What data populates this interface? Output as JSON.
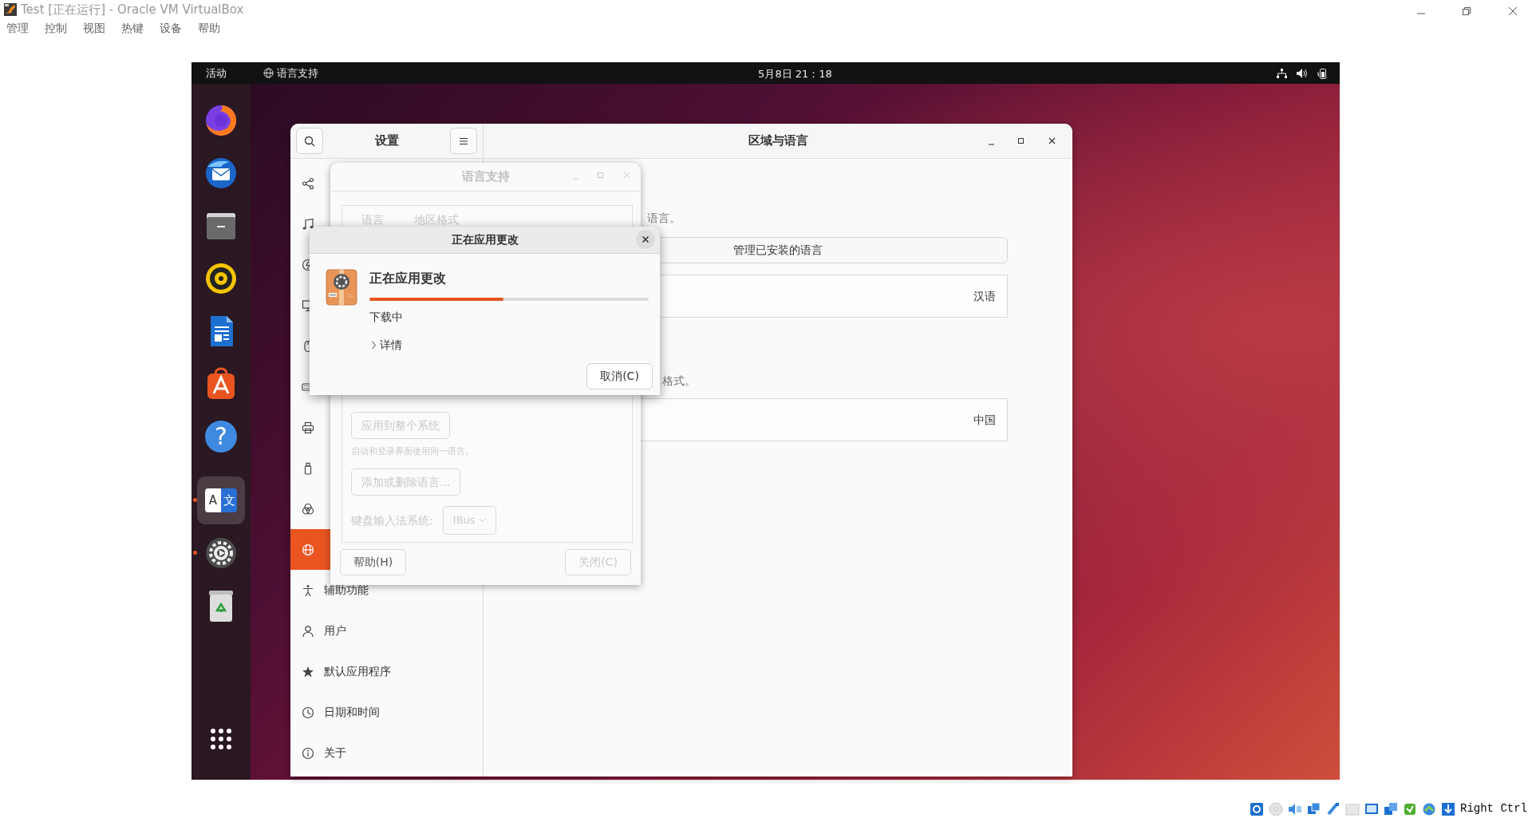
{
  "host": {
    "title": "Test [正在运行] - Oracle VM VirtualBox",
    "menu": [
      "管理",
      "控制",
      "视图",
      "热键",
      "设备",
      "帮助"
    ]
  },
  "topbar": {
    "activities": "活动",
    "app_name": "语言支持",
    "clock": "5月8日  21：18"
  },
  "dock": [
    {
      "kind": "firefox",
      "running": false,
      "selected": false
    },
    {
      "kind": "mail",
      "running": false,
      "selected": false
    },
    {
      "kind": "files",
      "running": false,
      "selected": false
    },
    {
      "kind": "music",
      "running": false,
      "selected": false
    },
    {
      "kind": "writer",
      "running": false,
      "selected": false
    },
    {
      "kind": "store",
      "running": false,
      "selected": false
    },
    {
      "kind": "help",
      "glyphs": [
        "?"
      ],
      "running": false,
      "selected": false
    },
    {
      "kind": "language",
      "glyphs": [
        "A",
        "文"
      ],
      "running": true,
      "selected": true
    },
    {
      "kind": "settings",
      "running": true,
      "selected": false
    },
    {
      "kind": "trash",
      "running": false,
      "selected": false
    },
    {
      "kind": "grid",
      "running": false,
      "selected": false
    }
  ],
  "settings": {
    "sidebar_title": "设置",
    "title": "区域与语言",
    "sidebar": [
      {
        "kind": "share",
        "selected": false
      },
      {
        "kind": "music",
        "selected": false
      },
      {
        "kind": "power",
        "selected": false
      },
      {
        "kind": "display",
        "selected": false
      },
      {
        "kind": "mouse",
        "selected": false
      },
      {
        "kind": "keyboard",
        "selected": false
      },
      {
        "kind": "printer",
        "selected": false
      },
      {
        "kind": "removable",
        "selected": false
      },
      {
        "kind": "color",
        "selected": false
      },
      {
        "kind": "globe",
        "selected": true
      },
      {
        "kind": "accessibility",
        "label": "辅助功能",
        "selected": false
      },
      {
        "kind": "user",
        "label": "用户",
        "selected": false
      },
      {
        "kind": "star",
        "label": "默认应用程序",
        "selected": false
      },
      {
        "kind": "clock",
        "label": "日期和时间",
        "selected": false
      },
      {
        "kind": "info",
        "label": "关于",
        "selected": false
      }
    ],
    "content": [
      {
        "kind": "note",
        "text": "语言。"
      },
      {
        "kind": "button",
        "text": "管理已安装的语言"
      },
      {
        "kind": "row",
        "value": "汉语"
      },
      {
        "kind": "note",
        "text": "格式。"
      },
      {
        "kind": "row",
        "value": "中国"
      }
    ]
  },
  "language_support": {
    "title": "语言支持",
    "tabs": [
      "语言",
      "地区格式"
    ],
    "apply_button": {
      "label": "应用到整个系统",
      "disabled": true
    },
    "login_note": "启动和登录界面使用同一语言。",
    "add_button": {
      "label": "添加或删除语言...",
      "disabled": true
    },
    "input_label": "键盘输入法系统:",
    "input_value": "IBus",
    "buttons": [
      {
        "label": "帮助(H)",
        "disabled": false
      },
      {
        "label": "关闭(C)",
        "disabled": true
      }
    ]
  },
  "progress": {
    "title": "正在应用更改",
    "heading": "正在应用更改",
    "level": 0.48,
    "status": "下载中",
    "details": {
      "label": "详情",
      "expanded": false
    },
    "cancel": "取消(C)"
  },
  "status_bar": {
    "host_key": "Right Ctrl"
  }
}
